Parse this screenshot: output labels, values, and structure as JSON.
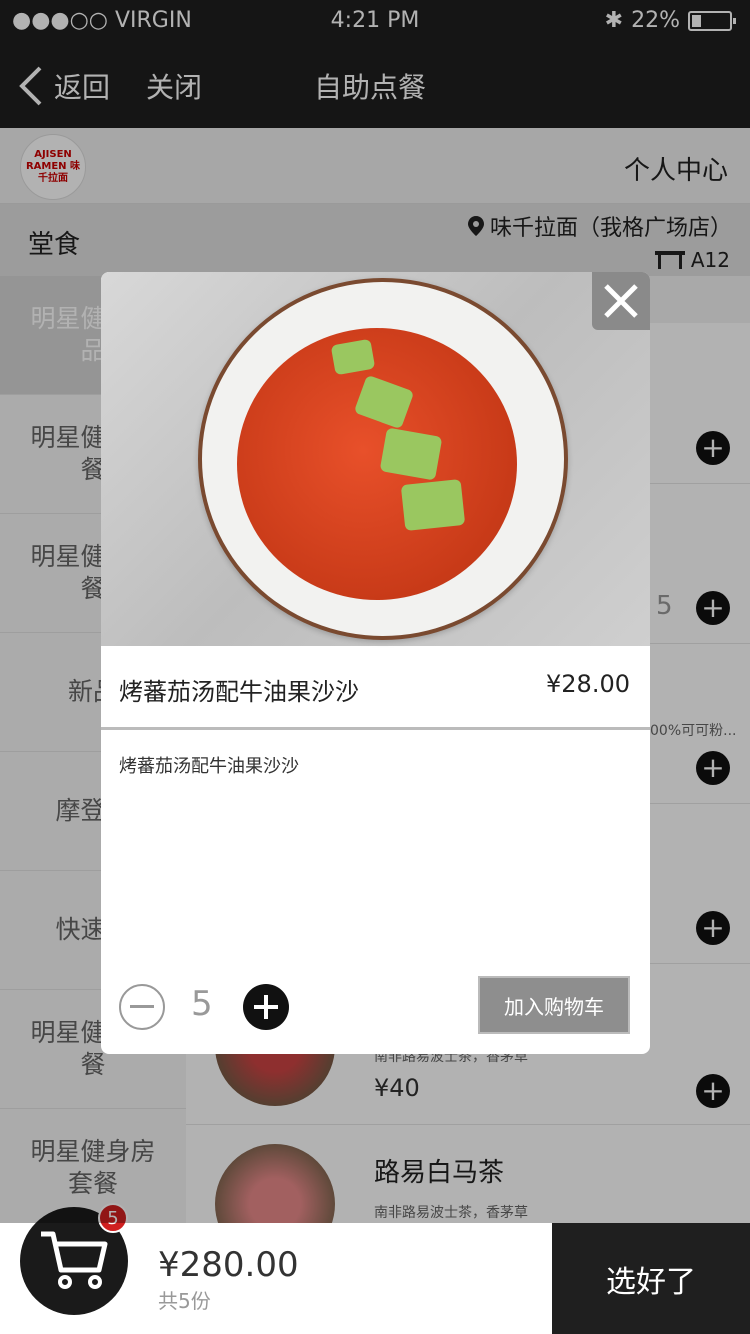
{
  "status_bar": {
    "carrier": "●●●○○ VIRGIN",
    "time": "4:21 PM",
    "battery": "22%"
  },
  "nav": {
    "back": "返回",
    "close": "关闭",
    "title": "自助点餐"
  },
  "header": {
    "logo_text": "AJISEN RAMEN 味千拉面",
    "personal_center": "个人中心"
  },
  "info": {
    "dine_type": "堂食",
    "store": "味千拉面（我格广场店）",
    "table": "A12"
  },
  "sidebar": {
    "items": [
      {
        "label": "明星健身单品"
      },
      {
        "label": "明星健身套餐"
      },
      {
        "label": "明星健身套餐"
      },
      {
        "label": "新品"
      },
      {
        "label": "摩登过"
      },
      {
        "label": "快速三"
      },
      {
        "label": "明星健身套餐"
      },
      {
        "label": "明星健身房套餐"
      }
    ]
  },
  "menu": {
    "visible_qty": "5",
    "snippet_text": "00%可可粉...",
    "item_partial": {
      "desc": "南非路易波士茶，香茅草",
      "price": "¥40"
    },
    "item_last": {
      "name": "路易白马茶",
      "desc": "南非路易波士茶，香茅草"
    }
  },
  "modal": {
    "name": "烤蕃茄汤配牛油果沙沙",
    "price": "¥28.00",
    "description": "烤蕃茄汤配牛油果沙沙",
    "quantity": "5",
    "add_to_cart": "加入购物车"
  },
  "cart": {
    "badge": "5",
    "total": "¥280.00",
    "count": "共5份",
    "done": "选好了"
  }
}
